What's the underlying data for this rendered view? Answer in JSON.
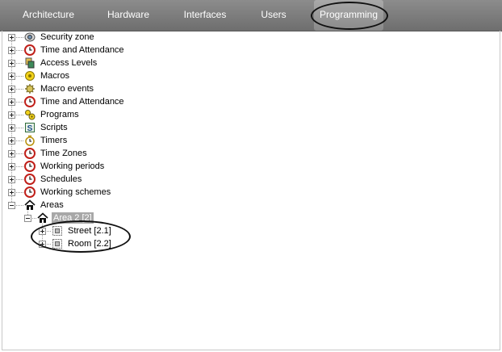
{
  "tabs": [
    {
      "label": "Architecture"
    },
    {
      "label": "Hardware"
    },
    {
      "label": "Interfaces"
    },
    {
      "label": "Users"
    },
    {
      "label": "Programming"
    }
  ],
  "tree": {
    "items": [
      {
        "label": "Security zone",
        "icon": "security-zone-icon"
      },
      {
        "label": "Time and Attendance",
        "icon": "clock-icon"
      },
      {
        "label": "Access Levels",
        "icon": "access-levels-icon"
      },
      {
        "label": "Macros",
        "icon": "macros-icon"
      },
      {
        "label": "Macro events",
        "icon": "macro-events-icon"
      },
      {
        "label": "Time and Attendance",
        "icon": "clock-icon"
      },
      {
        "label": "Programs",
        "icon": "programs-icon"
      },
      {
        "label": "Scripts",
        "icon": "scripts-icon"
      },
      {
        "label": "Timers",
        "icon": "timer-icon"
      },
      {
        "label": "Time Zones",
        "icon": "clock-icon"
      },
      {
        "label": "Working periods",
        "icon": "clock-icon"
      },
      {
        "label": "Schedules",
        "icon": "clock-icon"
      },
      {
        "label": "Working schemes",
        "icon": "clock-icon"
      },
      {
        "label": "Areas",
        "icon": "house-icon"
      }
    ],
    "area": {
      "label": "Area 2 [2]",
      "icon": "house-icon",
      "selected": true
    },
    "subareas": [
      {
        "label": "Street [2.1]",
        "icon": "subarea-icon"
      },
      {
        "label": "Room [2.2]",
        "icon": "subarea-icon"
      }
    ]
  },
  "colors": {
    "tabbar": "#7b7b7b",
    "selection": "#a8a8a8",
    "clock_red": "#c0201a"
  }
}
